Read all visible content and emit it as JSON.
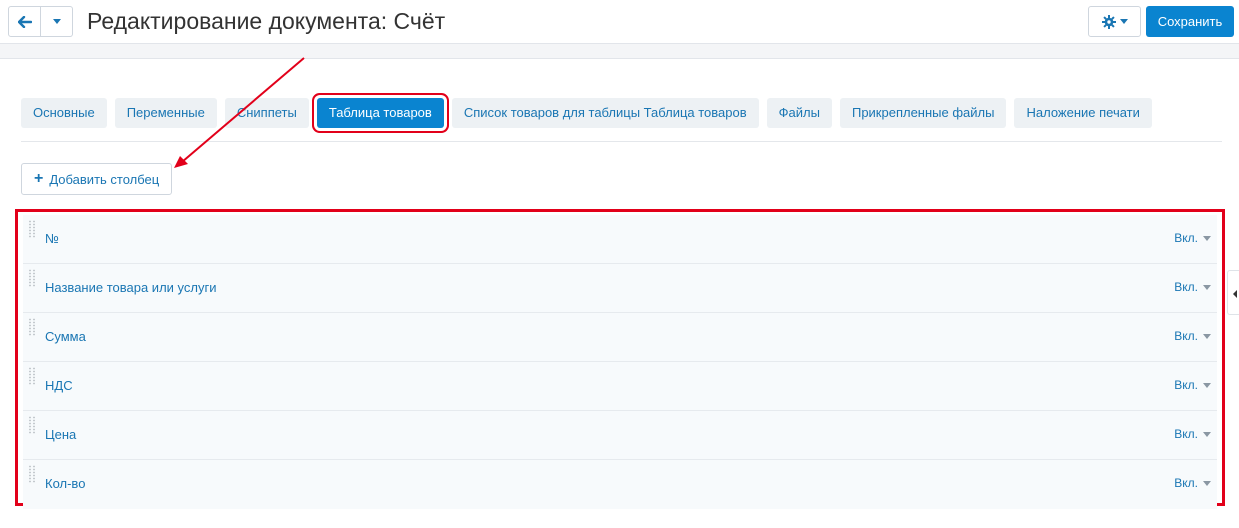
{
  "header": {
    "title": "Редактирование документа: Счёт",
    "save_label": "Сохранить"
  },
  "icons": {
    "back": "arrow-left-icon",
    "menu": "chevron-down-icon",
    "settings": "gear-icon",
    "add": "plus-icon",
    "drag": "drag-handle-icon"
  },
  "tabs": [
    {
      "label": "Основные"
    },
    {
      "label": "Переменные"
    },
    {
      "label": "Сниппеты"
    },
    {
      "label": "Таблица товаров",
      "active": true
    },
    {
      "label": "Список товаров для таблицы Таблица товаров"
    },
    {
      "label": "Файлы"
    },
    {
      "label": "Прикрепленные файлы"
    },
    {
      "label": "Наложение печати"
    }
  ],
  "toolbar": {
    "add_column_label": "Добавить столбец"
  },
  "columns": [
    {
      "name": "№",
      "status": "Вкл."
    },
    {
      "name": "Название товара или услуги",
      "status": "Вкл."
    },
    {
      "name": "Сумма",
      "status": "Вкл."
    },
    {
      "name": "НДС",
      "status": "Вкл."
    },
    {
      "name": "Цена",
      "status": "Вкл."
    },
    {
      "name": "Кол-во",
      "status": "Вкл."
    }
  ],
  "colors": {
    "accent": "#0a84d0",
    "link": "#1a76b3",
    "highlight": "#e2001a"
  }
}
